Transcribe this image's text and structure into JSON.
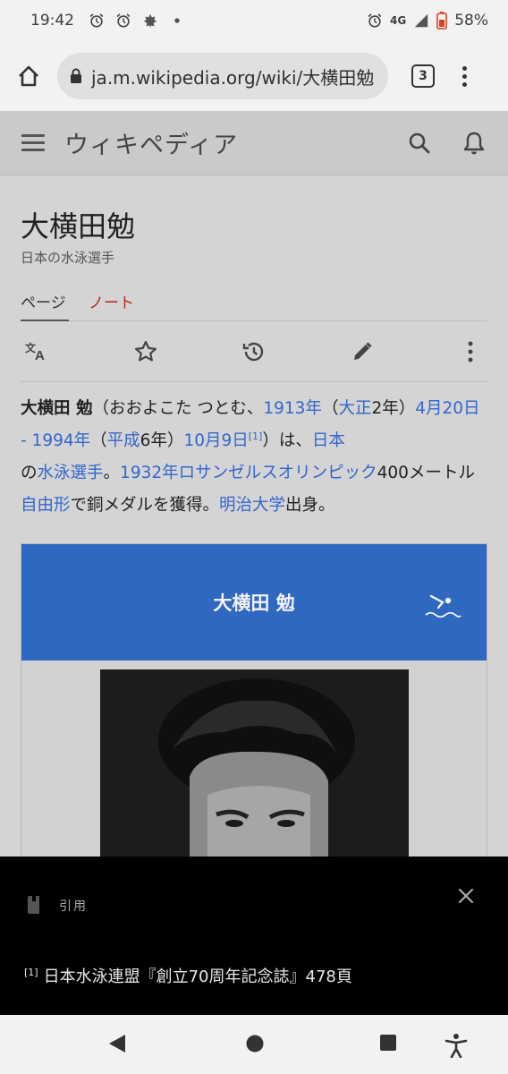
{
  "status_bar": {
    "time": "19:42",
    "network": "4G",
    "battery": "58%",
    "left_icons": [
      "alarm-icon",
      "alarm-icon",
      "leaf-icon",
      "dot-icon"
    ],
    "right_icons": [
      "alarm-icon",
      "signal-icon",
      "battery-icon"
    ]
  },
  "browser": {
    "url": "ja.m.wikipedia.org/wiki/大横田勉",
    "tab_count": "3"
  },
  "wiki_header": {
    "wordmark": "ウィキペディア"
  },
  "article": {
    "title": "大横田勉",
    "subtitle": "日本の水泳選手",
    "tabs": [
      {
        "label": "ページ",
        "active": true
      },
      {
        "label": "ノート",
        "active": false
      }
    ],
    "lead": {
      "bold_name": "大横田 勉",
      "p1": "（おおよこた つとむ、",
      "l_birthyear": "1913年",
      "p2": "（",
      "l_taisho": "大正",
      "p3": "2年）",
      "l_birthdate_range": "4月20日 - 1994年",
      "p4": "（",
      "l_heisei": "平成",
      "p5": "6年）",
      "l_deathdate": "10月9日",
      "ref": "[1]",
      "p6": "）は、",
      "l_japan": "日本",
      "p7": "の",
      "l_swimmer": "水泳選手",
      "p8": "。",
      "l_olympics": "1932年ロサンゼルスオリンピック",
      "p9": "400メートル",
      "l_freestyle": "自由形",
      "p10": "で銅メダルを獲得。",
      "l_meiji": "明治大学",
      "p11": "出身。"
    },
    "infobox": {
      "name": "大横田 勉"
    }
  },
  "reference_drawer": {
    "label": "引用",
    "ref_marker": "[1]",
    "text": "日本水泳連盟『創立70周年記念誌』478頁"
  },
  "colors": {
    "link": "#3366cc",
    "talk_tab": "#b32424",
    "infobox_header": "#2f68c0"
  }
}
